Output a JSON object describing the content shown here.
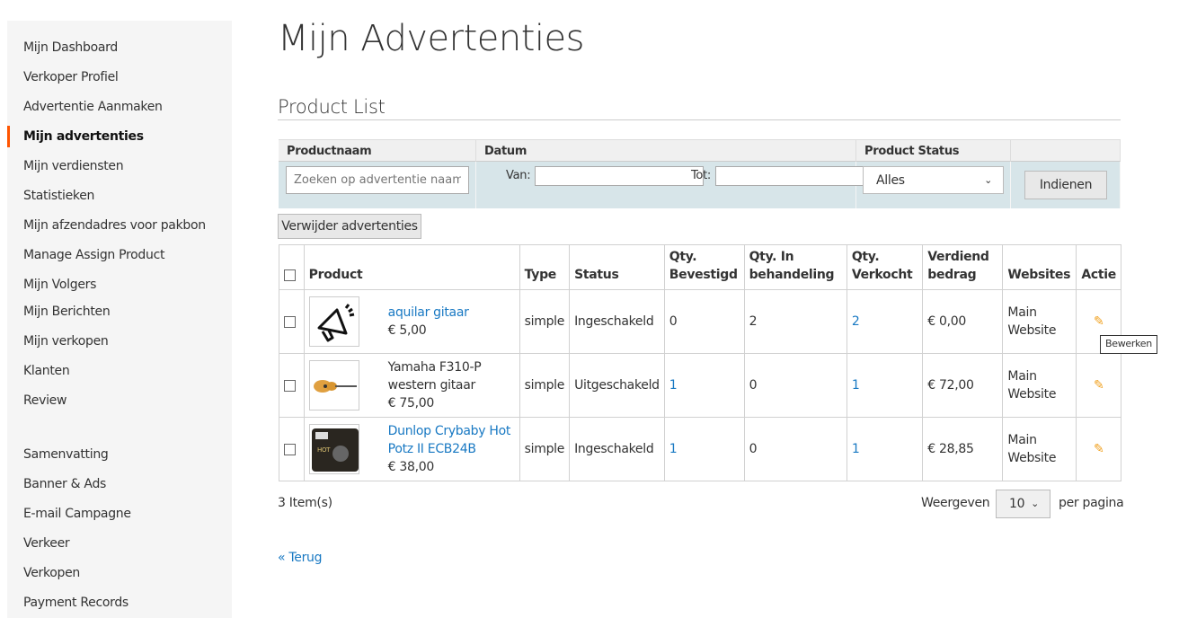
{
  "sidebar": {
    "group1": [
      "Mijn Dashboard",
      "Verkoper Profiel",
      "Advertentie Aanmaken",
      "Mijn advertenties",
      "Mijn verdiensten",
      "Statistieken",
      "Mijn afzendadres voor pakbon",
      "Manage Assign Product",
      "Mijn Volgers",
      "Mijn Berichten",
      "Mijn verkopen",
      "Klanten",
      "Review"
    ],
    "group2": [
      "Samenvatting",
      "Banner & Ads",
      "E-mail Campagne",
      "Verkeer",
      "Verkopen",
      "Payment Records"
    ],
    "active": "Mijn advertenties"
  },
  "page": {
    "title": "Mijn Advertenties",
    "subtitle": "Product List"
  },
  "filter": {
    "productnaam": "Productnaam",
    "datum": "Datum",
    "status": "Product Status",
    "search_placeholder": "Zoeken op advertentie naam",
    "van": "Van:",
    "tot": "Tot:",
    "status_value": "Alles",
    "submit": "Indienen"
  },
  "delete_button": "Verwijder advertenties",
  "table": {
    "headers": [
      "Product",
      "Type",
      "Status",
      "Qty. Bevestigd",
      "Qty. In behandeling",
      "Qty. Verkocht",
      "Verdiend bedrag",
      "Websites",
      "Actie"
    ],
    "rows": [
      {
        "name": "aquilar gitaar",
        "link": true,
        "price": "€ 5,00",
        "type": "simple",
        "status": "Ingeschakeld",
        "bevestigd": "0",
        "behandeling": "2",
        "verkocht": "2",
        "bedrag": "€ 0,00",
        "website": "Main Website",
        "thumb": "megaphone-icon"
      },
      {
        "name": "Yamaha F310-P western gitaar",
        "link": false,
        "price": "€ 75,00",
        "type": "simple",
        "status": "Uitgeschakeld",
        "bevestigd": "1",
        "behandeling": "0",
        "verkocht": "1",
        "bedrag": "€ 72,00",
        "website": "Main Website",
        "thumb": "guitar-image"
      },
      {
        "name": "Dunlop Crybaby Hot Potz II ECB24B",
        "link": true,
        "price": "€ 38,00",
        "type": "simple",
        "status": "Ingeschakeld",
        "bevestigd": "1",
        "behandeling": "0",
        "verkocht": "1",
        "bedrag": "€ 28,85",
        "website": "Main Website",
        "thumb": "pedal-image"
      }
    ]
  },
  "tooltip": "Bewerken",
  "footer": {
    "count": "3 Item(s)",
    "show": "Weergeven",
    "per_page_value": "10",
    "per_page": "per pagina",
    "back": "« Terug"
  },
  "colors": {
    "accent": "#ff5501",
    "link": "#1979c3",
    "edit": "#f0a01e",
    "filter_bg": "#d7e5e9"
  }
}
